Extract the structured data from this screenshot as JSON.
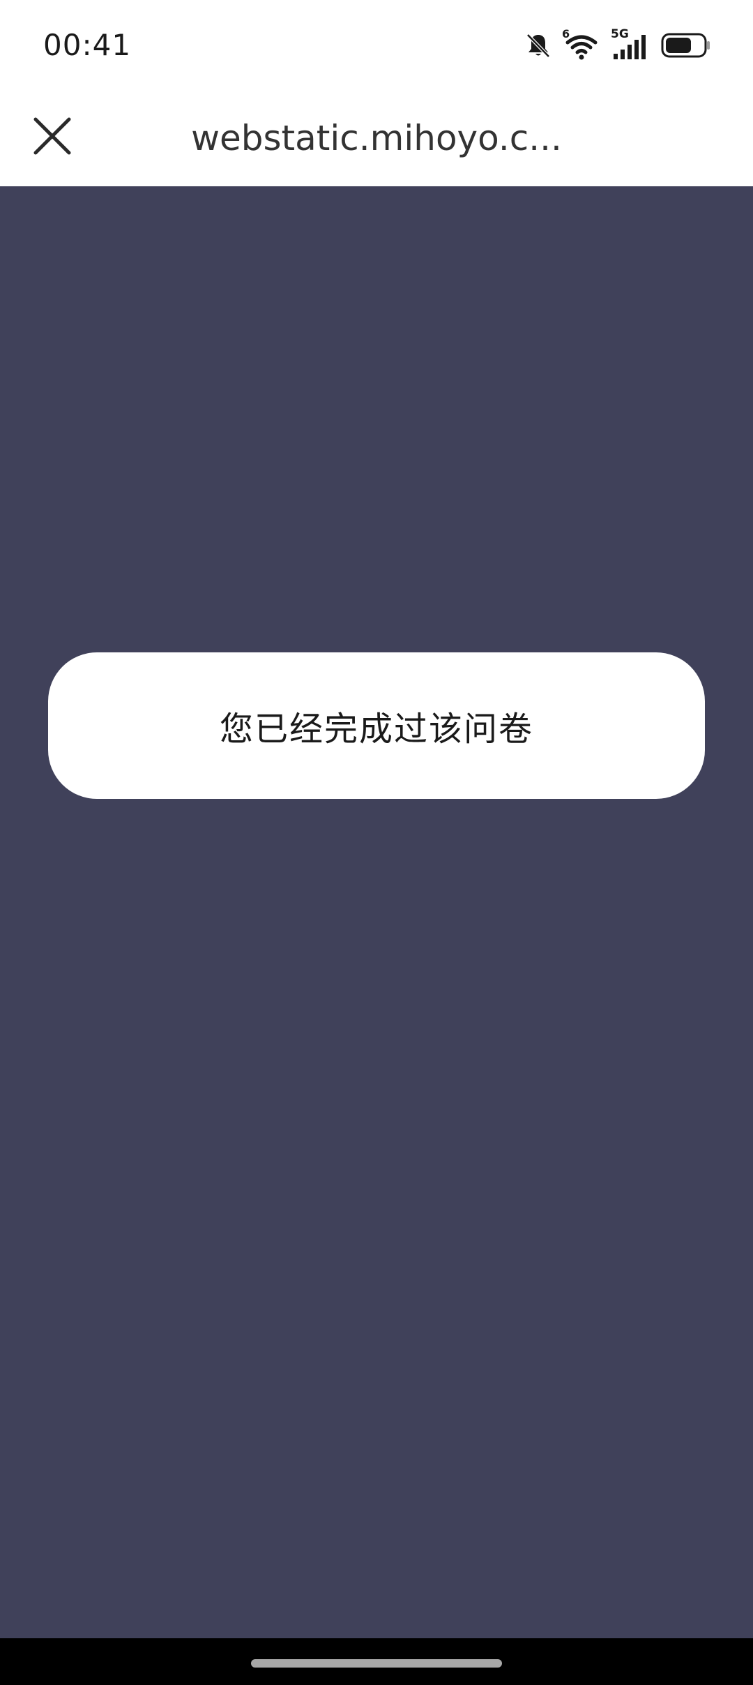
{
  "status_bar": {
    "time": "00:41",
    "network_label": "5G",
    "wifi_badge": "6",
    "icons": [
      "bell-muted-icon",
      "wifi-icon",
      "cellular-signal-icon",
      "battery-icon"
    ]
  },
  "nav": {
    "title": "webstatic.mihoyo.c...",
    "close_icon": "close-icon"
  },
  "toast": {
    "message": "您已经完成过该问卷"
  },
  "colors": {
    "background": "#40415a",
    "bar": "#ffffff",
    "text": "#1a1a1a"
  }
}
